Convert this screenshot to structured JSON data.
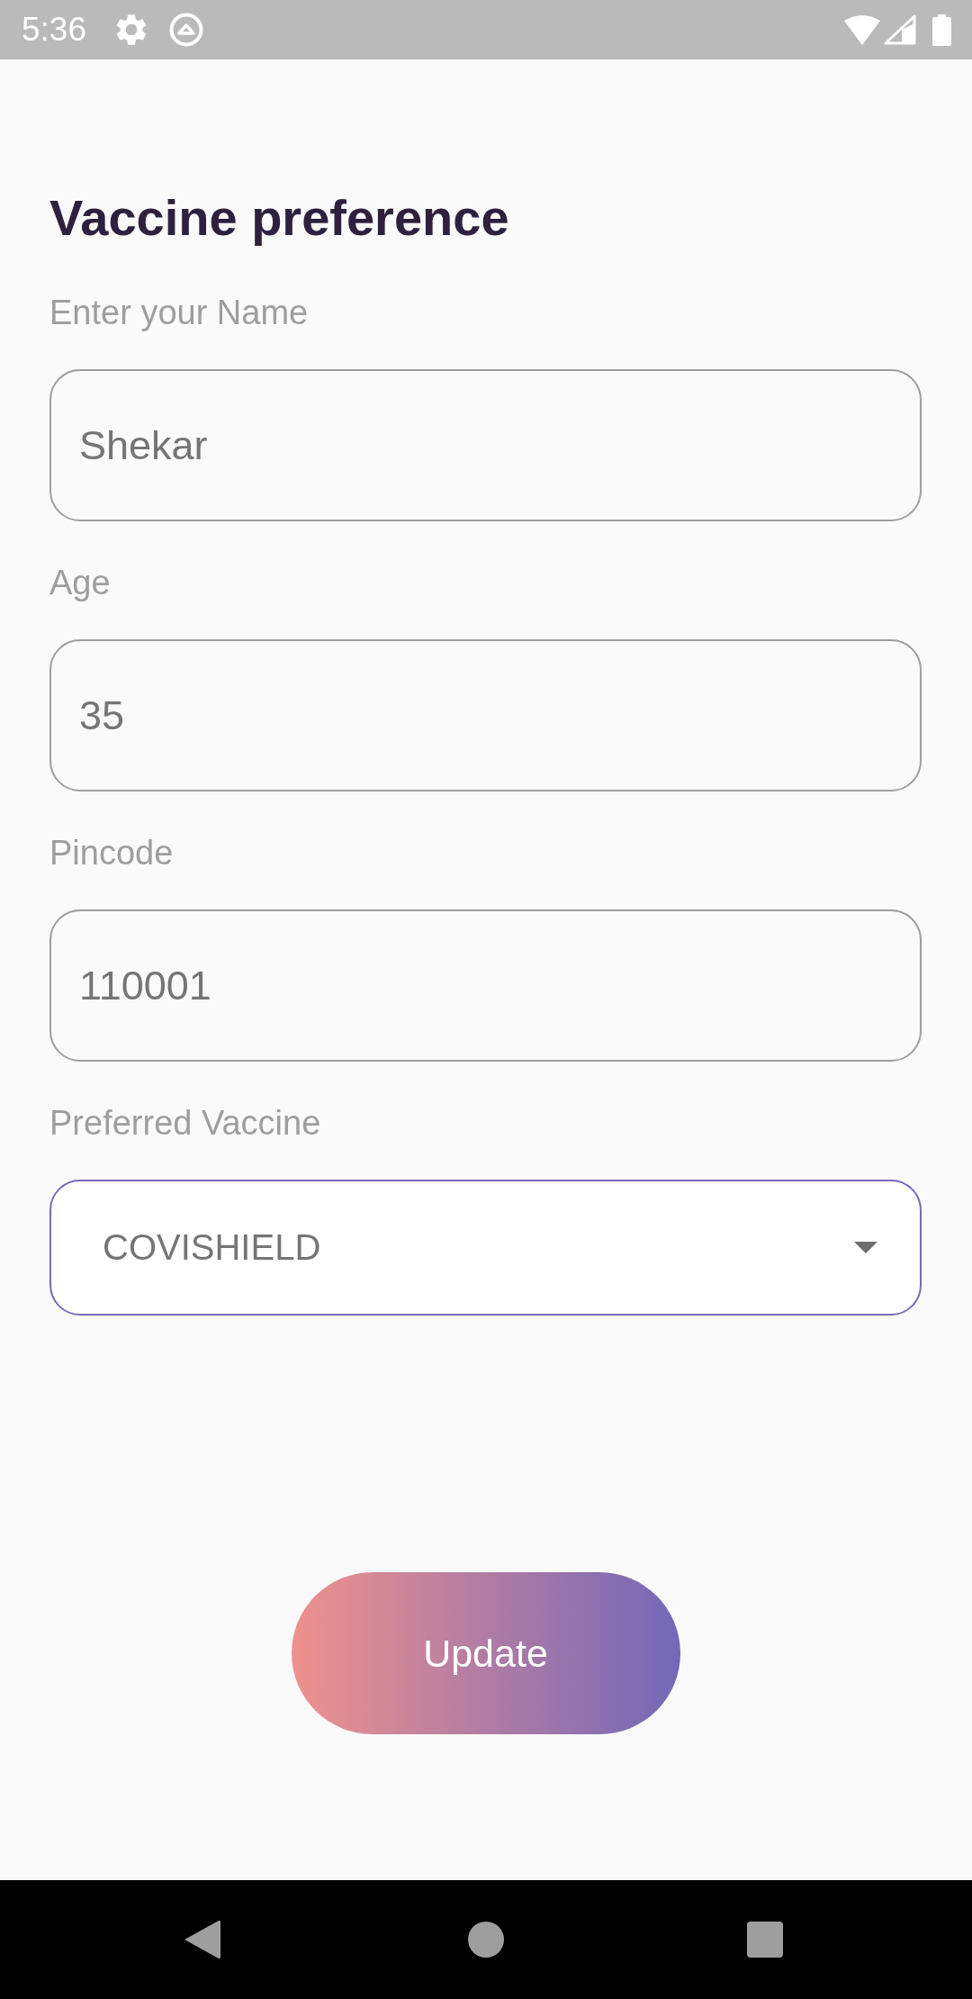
{
  "status_bar": {
    "time": "5:36"
  },
  "title": "Vaccine preference",
  "fields": [
    {
      "kind": "text",
      "label": "Enter your Name",
      "value": "Shekar"
    },
    {
      "kind": "text",
      "label": "Age",
      "value": "35"
    },
    {
      "kind": "text",
      "label": "Pincode",
      "value": "110001"
    },
    {
      "kind": "dropdown",
      "label": "Preferred Vaccine",
      "value": "COVISHIELD"
    }
  ],
  "button": {
    "label": "Update"
  }
}
